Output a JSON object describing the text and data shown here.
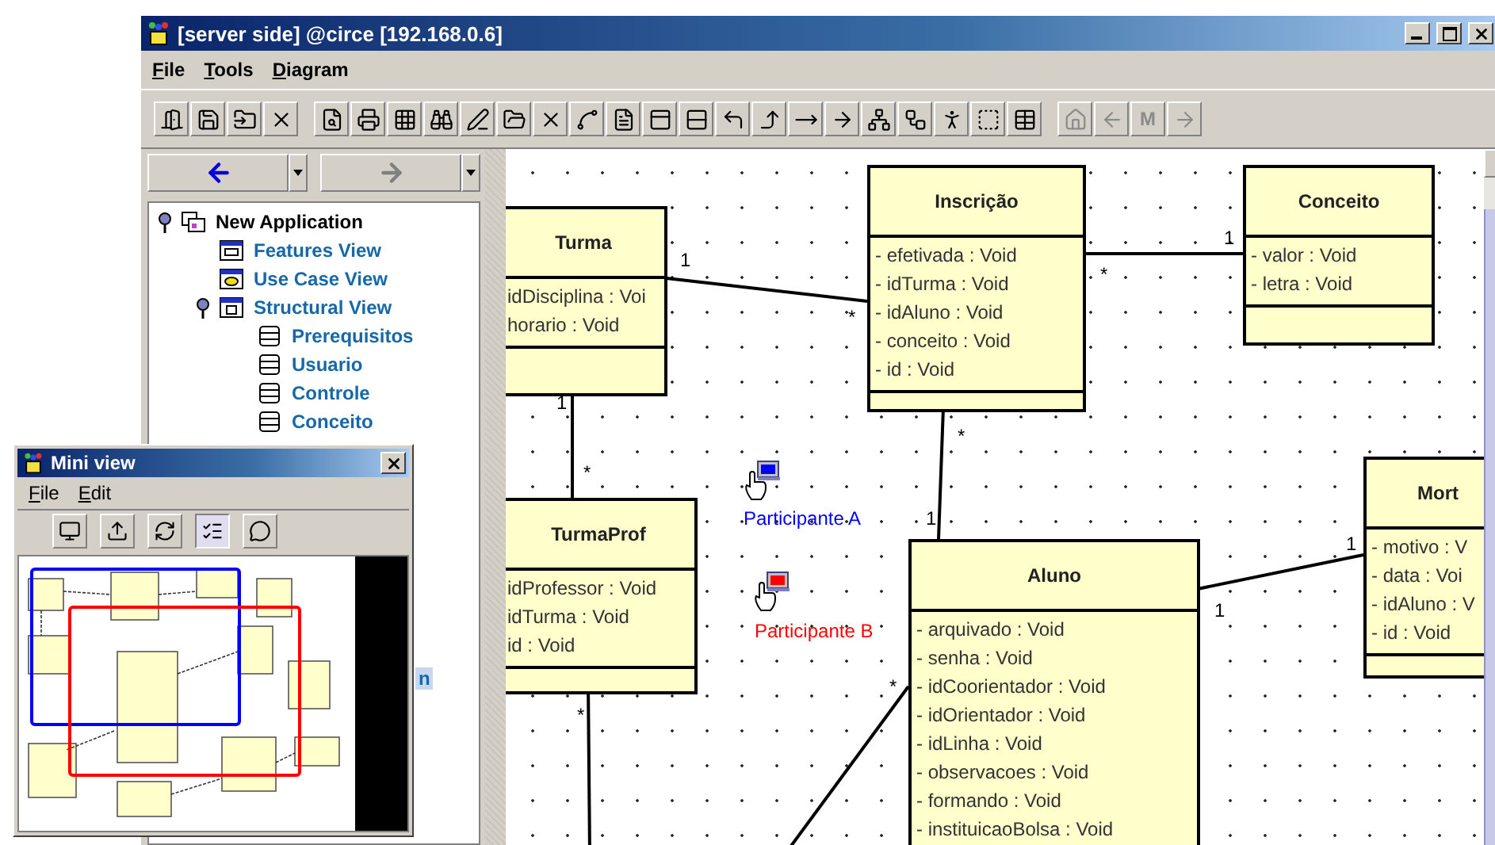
{
  "window": {
    "title": "[server side] @circe [192.168.0.6]"
  },
  "menu": [
    {
      "label": "File"
    },
    {
      "label": "Tools"
    },
    {
      "label": "Diagram"
    }
  ],
  "toolbar": {
    "groups": [
      [
        {
          "disabled": false
        },
        {
          "disabled": false
        },
        {
          "disabled": false
        },
        {
          "disabled": false
        }
      ],
      [
        {
          "disabled": false
        },
        {
          "disabled": false
        },
        {
          "disabled": false
        },
        {
          "disabled": false
        },
        {
          "disabled": false
        },
        {
          "disabled": false
        },
        {
          "disabled": false
        },
        {
          "disabled": false
        },
        {
          "disabled": false
        },
        {
          "disabled": false
        },
        {
          "disabled": false
        },
        {
          "disabled": false
        },
        {
          "disabled": false
        },
        {
          "disabled": false
        },
        {
          "disabled": false
        },
        {
          "disabled": false
        },
        {
          "disabled": false
        },
        {
          "disabled": false
        },
        {
          "disabled": false
        },
        {
          "disabled": false
        }
      ],
      [
        {
          "disabled": true
        },
        {
          "disabled": true
        },
        {
          "label": "M",
          "disabled": true
        },
        {
          "disabled": true
        }
      ]
    ]
  },
  "nav": {
    "back": {
      "disabled": false
    },
    "forward": {
      "disabled": true
    }
  },
  "tree": [
    {
      "label": "New Application",
      "kind": "application",
      "expanded": true,
      "selected": false,
      "children": [
        {
          "label": "Features View",
          "kind": "features",
          "selected": false
        },
        {
          "label": "Use Case View",
          "kind": "usecase",
          "selected": false
        },
        {
          "label": "Structural View",
          "kind": "structural",
          "expanded": true,
          "selected": false,
          "children": [
            {
              "label": "Prerequisitos",
              "kind": "class",
              "selected": false
            },
            {
              "label": "Usuario",
              "kind": "class",
              "selected": false
            },
            {
              "label": "Controle",
              "kind": "class",
              "selected": false
            },
            {
              "label": "Conceito",
              "kind": "class",
              "selected": false
            }
          ]
        }
      ]
    }
  ],
  "partial_item": {
    "label": "n",
    "selected": true
  },
  "classes": [
    {
      "name": "Turma",
      "attributes": [
        "idDisciplina : Voi",
        "horario : Void"
      ]
    },
    {
      "name": "Inscrição",
      "attributes": [
        "- efetivada : Void",
        "- idTurma : Void",
        "- idAluno : Void",
        "- conceito : Void",
        "- id : Void"
      ]
    },
    {
      "name": "Conceito",
      "attributes": [
        "- valor : Void",
        "- letra : Void"
      ]
    },
    {
      "name": "TurmaProf",
      "attributes": [
        "idProfessor : Void",
        "idTurma : Void",
        "id : Void"
      ]
    },
    {
      "name": "Aluno",
      "attributes": [
        "- arquivado : Void",
        "- senha : Void",
        "- idCoorientador : Void",
        "- idOrientador : Void",
        "- idLinha : Void",
        "- observacoes : Void",
        "- formando : Void",
        "- instituicaoBolsa : Void"
      ]
    },
    {
      "name": "Mort",
      "attributes": [
        "- motivo : V",
        "- data : Voi",
        "- idAluno : V",
        "- id : Void"
      ]
    }
  ],
  "associations": [
    {
      "labels": [
        "1",
        "*"
      ]
    },
    {
      "labels": [
        "*",
        "1"
      ]
    },
    {
      "labels": [
        "1",
        "*"
      ]
    },
    {
      "labels": [
        "*",
        "1"
      ]
    },
    {
      "labels": [
        "1",
        "1"
      ]
    },
    {
      "labels": [
        "*"
      ]
    },
    {
      "labels": [
        "*"
      ]
    }
  ],
  "participants": [
    {
      "name": "Participante A",
      "color": "#0000ff"
    },
    {
      "name": "Participante B",
      "color": "#ff0000"
    }
  ],
  "mini_view": {
    "title": "Mini view",
    "menu": [
      {
        "label": "File"
      },
      {
        "label": "Edit"
      }
    ],
    "tools": [
      {
        "selected": false
      },
      {
        "selected": false
      },
      {
        "selected": false
      },
      {
        "selected": true
      },
      {
        "selected": false
      }
    ]
  }
}
